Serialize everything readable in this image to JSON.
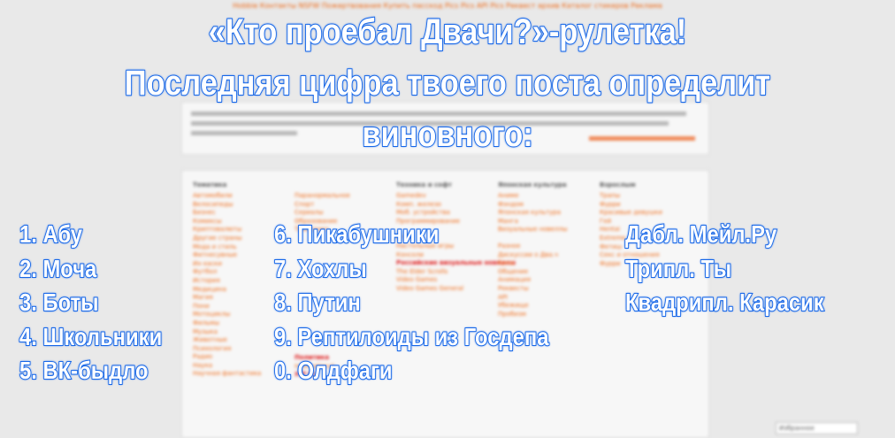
{
  "title": {
    "line1": "«Кто проебал Двачи?»-рулетка!",
    "line2": "Последняя цифра твоего поста определит",
    "line3": "виновного:"
  },
  "list_left": [
    "1. Абу",
    "2. Моча",
    "3. Боты",
    "4. Школьники",
    "5. ВК-быдло"
  ],
  "list_middle": [
    "6. Пикабушники",
    "7.  Хохлы",
    "8. Путин",
    "9. Рептилоиды из Госдепа",
    "0. Олдфаги"
  ],
  "list_right": [
    "Дабл. Мейл.Ру",
    "Трипл. Ты",
    "Квадрипл. Карасик"
  ],
  "background": {
    "top_links": "Hobbie  Контакты  NSFW  Пожертвования  Купить пасскод  Pics  Pics  API  Pics  Реквест архив  Каталог стикеров  Реклама",
    "columns": [
      {
        "head": "Тематика",
        "items": [
          "Автомобили",
          "Велосипеды",
          "Бизнес",
          "Комиксы",
          "Криптовалюты",
          "Другие страны",
          "Мода и стиль",
          "Фитнесувные",
          "Их-хаски",
          "Футбол",
          "История",
          "Медицина",
          "Магия",
          "Пони",
          "Мотоциклы",
          "Фильмы",
          "Музыка",
          "Животные",
          "Психология",
          "Радио",
          "Наука",
          "Научная фантастика"
        ]
      },
      {
        "head": "",
        "items": [
          "Паранормальное",
          "Спорт",
          "Сериалы",
          "Образование",
          "Транспорт",
          "",
          "",
          "",
          "",
          "",
          "",
          "",
          "",
          "",
          "",
          "",
          "",
          "",
          "",
          "",
          "Политика",
          "International",
          "Х Р Ю"
        ]
      },
      {
        "head": "Техника и софт",
        "items": [
          "Gamedev",
          "Комп. железо",
          "Моб. устройства",
          "Программирование",
          "",
          "Игры",
          "Настольные игры",
          "Консоли",
          "Российские визуальные новеллы",
          "The Elder Scrolls",
          "Video Games",
          "Video Games General"
        ]
      },
      {
        "head": "Японская культура",
        "items": [
          "Аниме",
          "Фэндом",
          "Японская культура",
          "Манга",
          "Визуальные новеллы",
          "",
          "Разное",
          "Дискуссии о Два.ч",
          "Бред",
          "Общение",
          "Анимация",
          "Реквесты",
          "API",
          "Убежище",
          "Пробизм"
        ]
      },
      {
        "head": "Взрослым",
        "items": [
          "Трапы",
          "Фурри",
          "Красивые девушки",
          "Гей",
          "Hentai",
          "Extreme",
          "Фетиш",
          "Секс и отношения",
          "Фурри"
        ]
      }
    ],
    "select_label": "Избранное"
  },
  "colors": {
    "overlay_fill": "#ffffff",
    "overlay_stroke": "#1767e8",
    "board_link": "#ee6611",
    "page_bg": "#e9e9e9"
  }
}
